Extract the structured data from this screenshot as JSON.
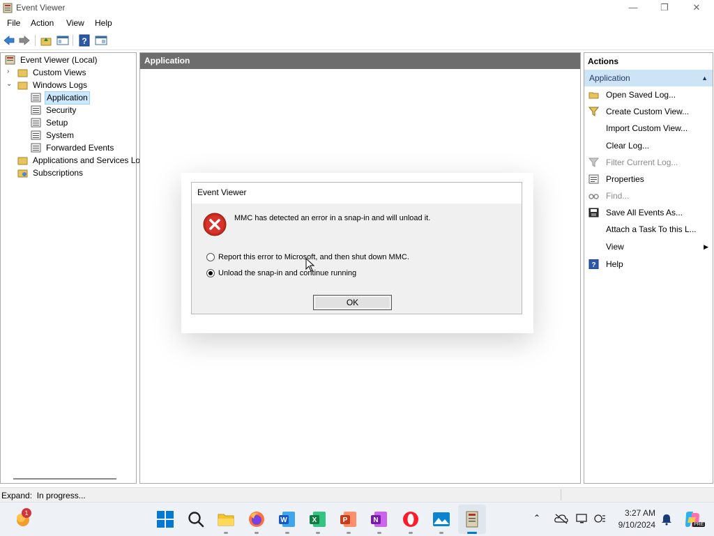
{
  "window": {
    "title": "Event Viewer",
    "controls": {
      "minimize": "—",
      "restore": "❐",
      "close": "✕"
    }
  },
  "menubar": [
    "File",
    "Action",
    "View",
    "Help"
  ],
  "tree": {
    "root": "Event Viewer (Local)",
    "custom_views": "Custom Views",
    "windows_logs": "Windows Logs",
    "logs": [
      "Application",
      "Security",
      "Setup",
      "System",
      "Forwarded Events"
    ],
    "apps_services": "Applications and Services Lo",
    "subscriptions": "Subscriptions"
  },
  "center": {
    "header": "Application"
  },
  "actions": {
    "header": "Actions",
    "section": "Application",
    "items": [
      {
        "label": "Open Saved Log...",
        "icon": "folder-open-icon",
        "enabled": true
      },
      {
        "label": "Create Custom View...",
        "icon": "filter-icon",
        "enabled": true
      },
      {
        "label": "Import Custom View...",
        "icon": "",
        "enabled": true
      },
      {
        "label": "Clear Log...",
        "icon": "",
        "enabled": true
      },
      {
        "label": "Filter Current Log...",
        "icon": "filter-icon",
        "enabled": false
      },
      {
        "label": "Properties",
        "icon": "properties-icon",
        "enabled": true
      },
      {
        "label": "Find...",
        "icon": "find-icon",
        "enabled": false
      },
      {
        "label": "Save All Events As...",
        "icon": "save-icon",
        "enabled": true
      },
      {
        "label": "Attach a Task To this L...",
        "icon": "",
        "enabled": true
      },
      {
        "label": "View",
        "icon": "",
        "enabled": true,
        "submenu": true
      },
      {
        "label": "Help",
        "icon": "help-icon",
        "enabled": true
      }
    ]
  },
  "statusbar": {
    "text": "Expand:  In progress..."
  },
  "dialog": {
    "title": "Event Viewer",
    "message": "MMC has detected an error in a snap-in and will unload it.",
    "options": [
      {
        "label": "Report this error to Microsoft, and then shut down MMC.",
        "selected": false
      },
      {
        "label": "Unload the snap-in and continue running",
        "selected": true
      }
    ],
    "ok_label": "OK"
  },
  "taskbar": {
    "notification_badge": "1",
    "clock": {
      "time": "3:27 AM",
      "date": "9/10/2024"
    },
    "copilot_badge": "PRE",
    "colors": {
      "accent": "#0078d4",
      "error_red": "#c42b1c"
    }
  }
}
